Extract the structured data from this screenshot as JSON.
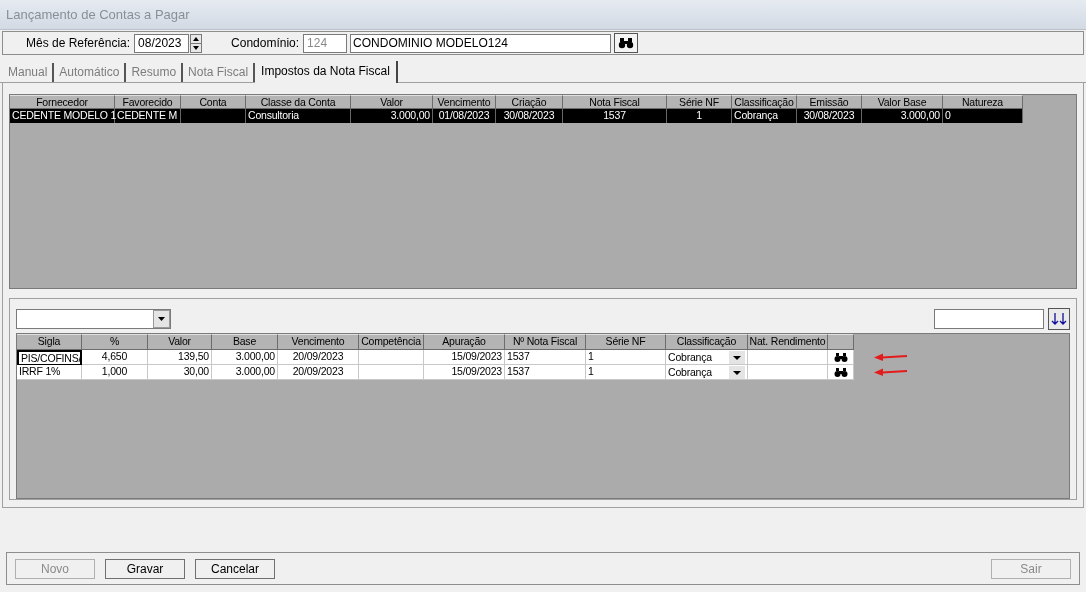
{
  "window": {
    "title": "Lançamento de Contas a Pagar"
  },
  "header": {
    "month_label": "Mês de Referência:",
    "month_value": "08/2023",
    "condo_label": "Condomínio:",
    "condo_code": {
      "value": "124",
      "disabled": true
    },
    "condo_name": "CONDOMINIO MODELO124"
  },
  "tabs": [
    {
      "label": "Manual",
      "selected": false
    },
    {
      "label": "Automático",
      "selected": false
    },
    {
      "label": "Resumo",
      "selected": false
    },
    {
      "label": "Nota Fiscal",
      "selected": false
    },
    {
      "label": "Impostos da Nota Fiscal",
      "selected": true
    }
  ],
  "bills_table": {
    "columns": [
      "Fornecedor",
      "Favorecido",
      "Conta",
      "Classe da Conta",
      "Valor",
      "Vencimento",
      "Criação",
      "Nota Fiscal",
      "Série NF",
      "Classificação",
      "Emissão",
      "Valor Base",
      "Natureza"
    ],
    "rows": [
      {
        "selected": true,
        "cells": [
          "CEDENTE MODELO 1",
          "CEDENTE M",
          "",
          "Consultoria",
          "3.000,00",
          "01/08/2023",
          "30/08/2023",
          "1537",
          "1",
          "Cobrança",
          "30/08/2023",
          "3.000,00",
          "0"
        ]
      }
    ]
  },
  "tax_table": {
    "columns": [
      "Sigla",
      "%",
      "Valor",
      "Base",
      "Vencimento",
      "Competência",
      "Apuração",
      "Nº Nota Fiscal",
      "Série NF",
      "Classificação",
      "Nat. Rendimento"
    ],
    "rows": [
      {
        "focused": true,
        "cells": [
          "PIS/COFINS/",
          "4,650",
          "139,50",
          "3.000,00",
          "20/09/2023",
          "",
          "15/09/2023",
          "1537",
          "1",
          "Cobrança",
          ""
        ]
      },
      {
        "focused": false,
        "cells": [
          "IRRF 1%",
          "1,000",
          "30,00",
          "3.000,00",
          "20/09/2023",
          "",
          "15/09/2023",
          "1537",
          "1",
          "Cobrança",
          ""
        ]
      }
    ]
  },
  "buttons": [
    {
      "label": "Novo",
      "disabled": true
    },
    {
      "label": "Gravar",
      "disabled": false
    },
    {
      "label": "Cancelar",
      "disabled": false
    },
    {
      "label": "Sair",
      "disabled": true
    }
  ]
}
